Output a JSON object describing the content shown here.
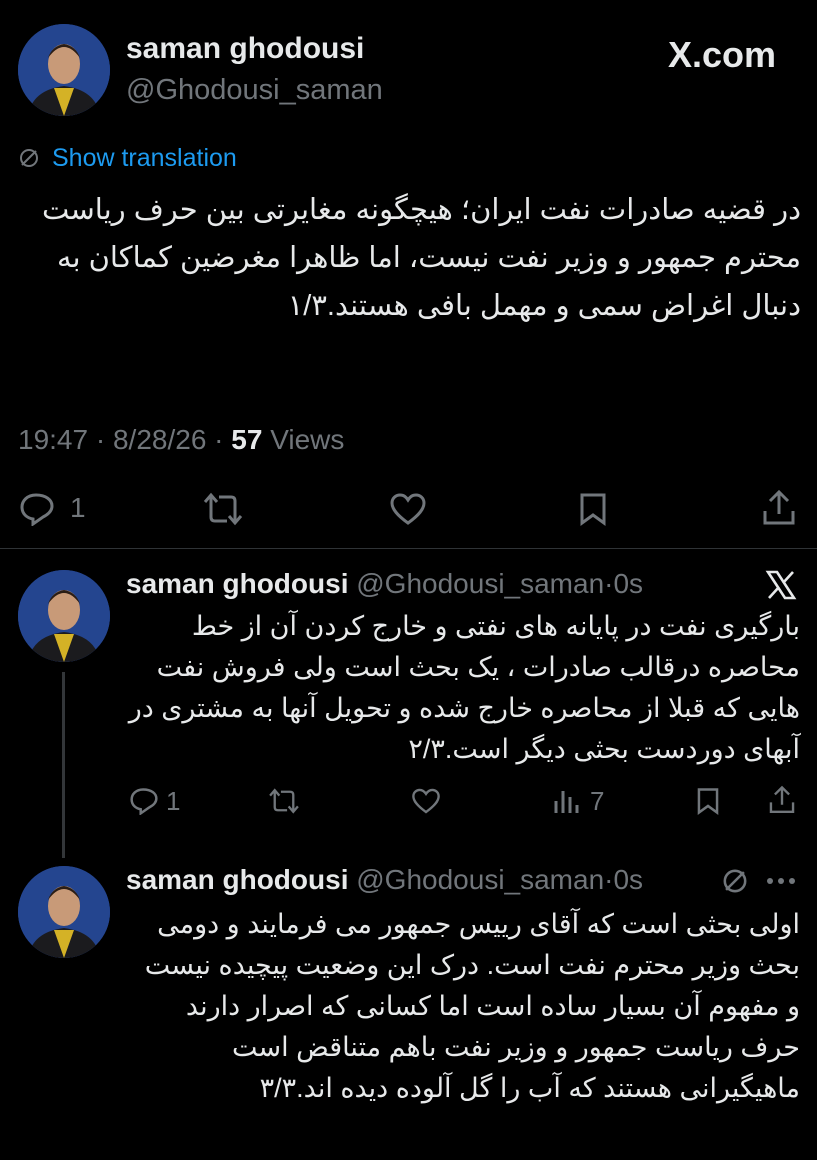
{
  "main": {
    "author_name": "saman ghodousi",
    "author_handle": "@Ghodousi_saman",
    "site_label": "X.com",
    "translate_label": "Show translation",
    "text": "در قضیه صادرات نفت ایران؛ هیچگونه مغایرتی بین حرف ریاست محترم جمهور و وزیر نفت نیست، اما ظاهرا مغرضین کماکان به دنبال اغراض سمی و مهمل بافی هستند.۱/۳",
    "time": "19:47",
    "date": "8/28/26",
    "views_count": "57",
    "views_label": "Views",
    "reply_count": "1"
  },
  "reply1": {
    "author_name": "saman ghodousi",
    "author_handle": "@Ghodousi_saman",
    "age": "0s",
    "text": "بارگیری نفت در پایانه های نفتی و خارج کردن آن از خط محاصره درقالب صادرات ، یک بحث است ولی فروش نفت هایی که قبلا از محاصره خارج شده و تحویل آنها به مشتری در آبهای دوردست بحثی دیگر است.۲/۳",
    "reply_count": "1",
    "views_count": "7"
  },
  "reply2": {
    "author_name": "saman ghodousi",
    "author_handle": "@Ghodousi_saman",
    "age": "0s",
    "text": "اولی بحثی است که آقای رییس جمهور می فرمایند و دومی بحث وزیر محترم نفت است. درک این وضعیت پیچیده نیست و مفهوم آن بسیار ساده است اما کسانی که اصرار دارند حرف ریاست جمهور و وزیر نفت باهم متناقض است ماهیگیرانی هستند که آب را گل آلوده دیده اند.۳/۳"
  },
  "icons": [
    "x-logo",
    "translate-icon",
    "reply-icon",
    "retweet-icon",
    "like-icon",
    "bookmark-icon",
    "share-icon",
    "views-icon",
    "more-icon"
  ],
  "colors": {
    "background": "#000000",
    "text": "#e7e9ea",
    "muted": "#71767b",
    "link": "#1d9bf0",
    "divider": "#2f3336"
  }
}
